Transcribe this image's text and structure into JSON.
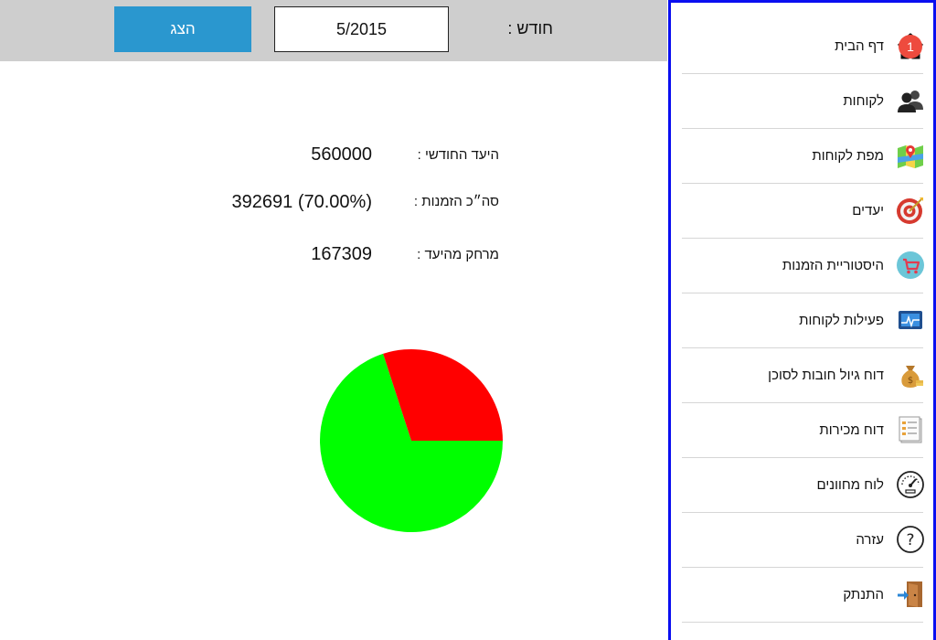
{
  "header": {
    "show_button_label": "הצג",
    "month_value": "5/2015",
    "month_label": "חודש :"
  },
  "stats": {
    "target_label": "היעד החודשי :",
    "target_value": "560000",
    "orders_label": "סה״כ הזמנות :",
    "orders_value": "392691 (70.00%)",
    "remaining_label": "מרחק מהיעד :",
    "remaining_value": "167309"
  },
  "chart_data": {
    "type": "pie",
    "slices": [
      {
        "name": "",
        "value": 70.0,
        "color": "#00ff00"
      },
      {
        "name": "",
        "value": 30.0,
        "color": "#ff0000"
      }
    ]
  },
  "sidebar": {
    "badge_count": "1",
    "items": [
      {
        "label": "דף הבית",
        "icon": "home-icon"
      },
      {
        "label": "לקוחות",
        "icon": "users-icon"
      },
      {
        "label": "מפת לקוחות",
        "icon": "map-icon"
      },
      {
        "label": "יעדים",
        "icon": "target-icon"
      },
      {
        "label": "היסטוריית הזמנות",
        "icon": "cart-icon"
      },
      {
        "label": "פעילות לקוחות",
        "icon": "activity-icon"
      },
      {
        "label": "דוח גיול חובות לסוכן",
        "icon": "money-bag-icon"
      },
      {
        "label": "דוח מכירות",
        "icon": "report-icon"
      },
      {
        "label": "לוח מחוונים",
        "icon": "gauge-icon"
      },
      {
        "label": "עזרה",
        "icon": "help-icon"
      },
      {
        "label": "התנתק",
        "icon": "logout-icon"
      }
    ]
  }
}
